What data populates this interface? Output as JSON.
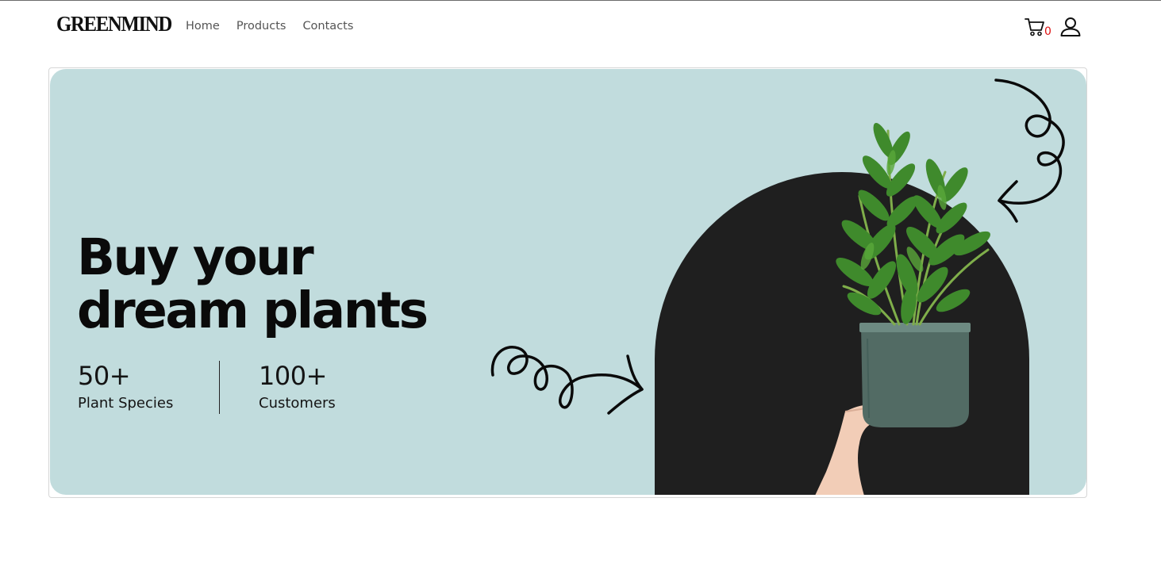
{
  "brand": {
    "logo": "GREENMIND"
  },
  "nav": {
    "items": [
      "Home",
      "Products",
      "Contacts"
    ]
  },
  "cart": {
    "icon": "cart-icon",
    "count": "0",
    "count_color": "#dd1111"
  },
  "user": {
    "icon": "user-icon"
  },
  "hero": {
    "headline_line1": "Buy your",
    "headline_line2": "dream plants",
    "background": "#c1dcdd",
    "arch_color": "#1f1f1f",
    "stats": [
      {
        "value": "50+",
        "label": "Plant Species"
      },
      {
        "value": "100+",
        "label": "Customers"
      }
    ]
  }
}
